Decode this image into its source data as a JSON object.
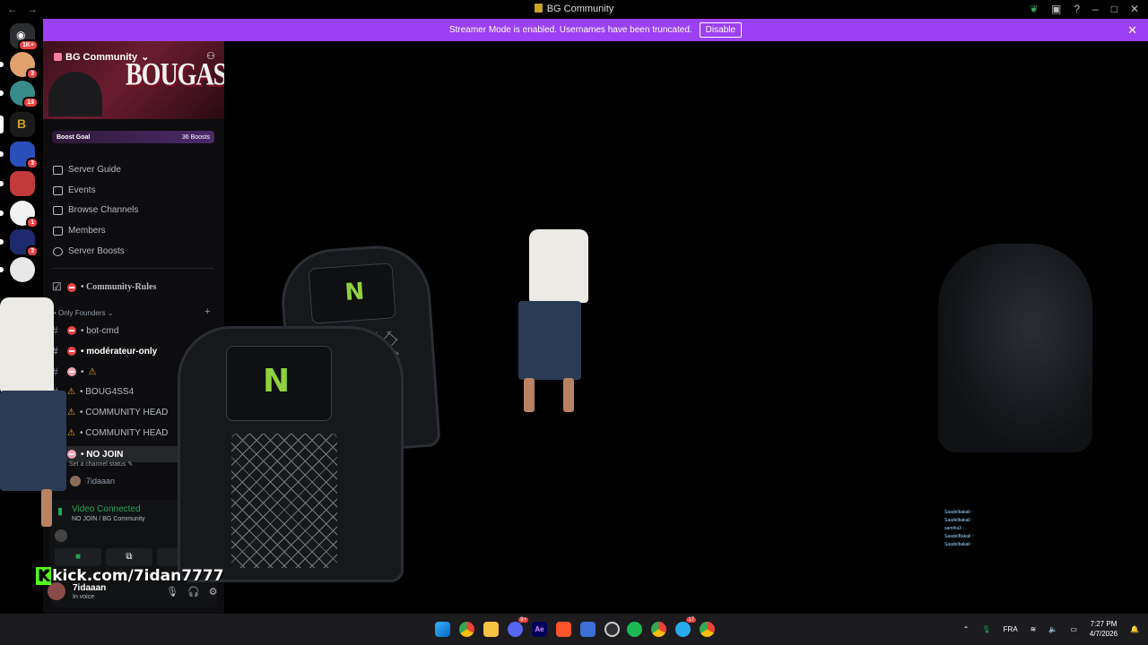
{
  "window": {
    "title": "BG Community"
  },
  "banner": {
    "message": "Streamer Mode is enabled. Usernames have been truncated.",
    "disable_label": "Disable"
  },
  "servers": [
    {
      "name": "home",
      "badge": "1K+"
    },
    {
      "name": "server-2",
      "badge": "3"
    },
    {
      "name": "server-3",
      "badge": "19"
    },
    {
      "name": "bg-community",
      "badge": ""
    },
    {
      "name": "lounge",
      "badge": "3"
    },
    {
      "name": "server-6",
      "badge": ""
    },
    {
      "name": "server-7",
      "badge": "1"
    },
    {
      "name": "server-8",
      "badge": "3"
    },
    {
      "name": "server-9",
      "badge": ""
    }
  ],
  "sidebar": {
    "server_name": "BG Community",
    "banner_art_text": "BOUGASSAA",
    "boost_goal": "Boost Goal",
    "boost_count": "36 Boosts",
    "menu": [
      "Server Guide",
      "Events",
      "Browse Channels",
      "Members",
      "Server Boosts"
    ],
    "rules_channel": "• Community-Rules",
    "category": "Only Founders",
    "channels": [
      {
        "label": "• bot-cmd"
      },
      {
        "label": "• modérateur-only"
      },
      {
        "label": "•"
      },
      {
        "label": "• BOUG4SS4"
      },
      {
        "label": "• COMMUNITY HEAD"
      },
      {
        "label": "• COMMUNITY HEAD"
      },
      {
        "label": "• NO JOIN"
      }
    ],
    "channel_status": "Set a channel status",
    "voice_user": "7idaaan"
  },
  "voice": {
    "status": "Video Connected",
    "location": "NO JOIN / BG Community"
  },
  "overlay": {
    "kick_url": "kick.com/7idan7777"
  },
  "user": {
    "name": "7idaaan",
    "status": "In voice"
  },
  "chatlog": [
    "Saadelbakali :",
    "Saadelbakali :",
    "samiha3 :",
    "SaadelBakali :",
    "Saadelbakali :"
  ],
  "taskbar": {
    "lang": "FRA",
    "time": "7:27 PM",
    "date": "4/7/2026",
    "discord_badge": "9+",
    "telegram_badge": "17"
  }
}
